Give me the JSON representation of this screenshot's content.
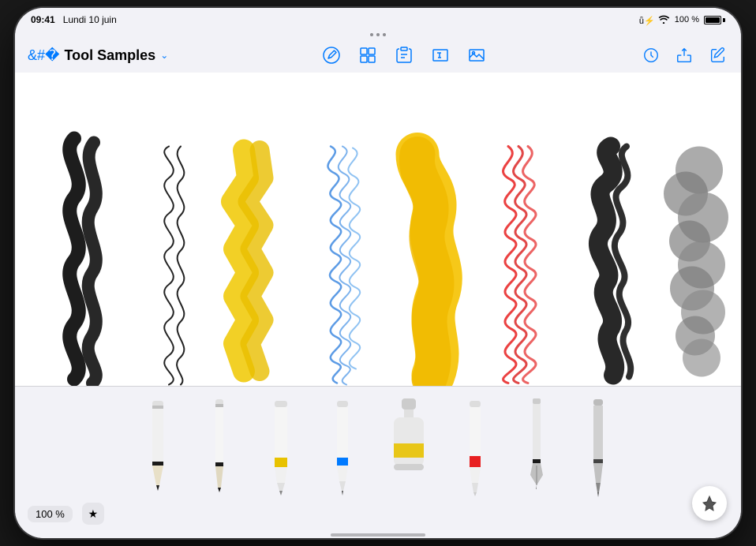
{
  "status": {
    "time": "09:41",
    "date": "Lundi 10 juin",
    "wifi": "wifi",
    "battery": "100 %"
  },
  "nav": {
    "back_label": "Tool Samples",
    "dropdown_char": "∨",
    "icons": [
      "pencil-circle",
      "browser-grid",
      "clipboard",
      "text-box",
      "image-frame"
    ],
    "right_icons": [
      "clock",
      "share",
      "edit"
    ]
  },
  "tools": [
    {
      "name": "pencil",
      "color": "#1a1a1a",
      "band_color": "#1a1a1a",
      "type": "pencil"
    },
    {
      "name": "pen",
      "color": "#1a1a1a",
      "band_color": "#1a1a1a",
      "type": "finepen"
    },
    {
      "name": "marker-yellow",
      "color": "#e8c200",
      "band_color": "#e8c200",
      "type": "marker"
    },
    {
      "name": "marker-blue",
      "color": "#007AFF",
      "band_color": "#007AFF",
      "type": "felt"
    },
    {
      "name": "paint",
      "color": "#e5e5e5",
      "band_color": "#e8c200",
      "type": "paint"
    },
    {
      "name": "crayon-red",
      "color": "#e82020",
      "band_color": "#e82020",
      "type": "crayon"
    },
    {
      "name": "nib-pen",
      "color": "#1a1a1a",
      "band_color": "#1a1a1a",
      "type": "nibpen"
    },
    {
      "name": "brush",
      "color": "#666",
      "band_color": "#555",
      "type": "brush"
    }
  ],
  "bottom": {
    "zoom_label": "100 %",
    "fav_icon": "★"
  },
  "canvas": {
    "strokes": [
      {
        "type": "snake-thick",
        "color": "#1a1a1a"
      },
      {
        "type": "loops",
        "color": "#1a1a1a"
      },
      {
        "type": "zigzag-yellow",
        "color": "#e8c200"
      },
      {
        "type": "scribble-blue",
        "color": "#007AFF"
      },
      {
        "type": "blob-yellow",
        "color": "#f5c200"
      },
      {
        "type": "scribble-red",
        "color": "#e82020"
      },
      {
        "type": "calligraphy",
        "color": "#1a1a1a"
      },
      {
        "type": "smoke",
        "color": "#555"
      }
    ]
  }
}
